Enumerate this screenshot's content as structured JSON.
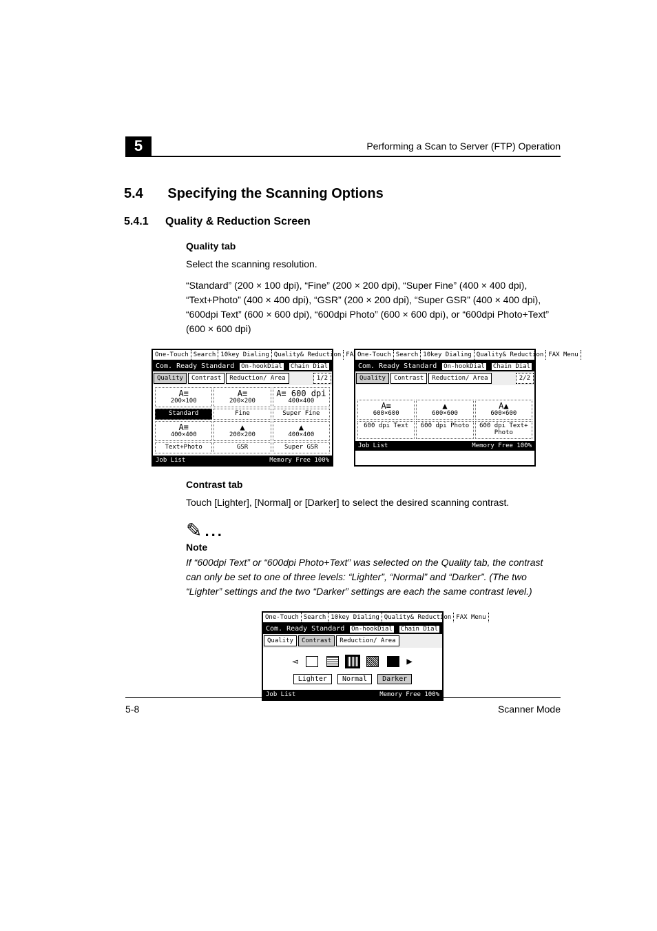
{
  "chapter_number": "5",
  "running_head": "Performing a Scan to Server (FTP) Operation",
  "section": {
    "number": "5.4",
    "title": "Specifying the Scanning Options"
  },
  "subsection": {
    "number": "5.4.1",
    "title": "Quality & Reduction Screen"
  },
  "quality": {
    "heading": "Quality tab",
    "intro": "Select the scanning resolution.",
    "body": "“Standard” (200 × 100 dpi), “Fine” (200 × 200 dpi), “Super Fine” (400 × 400 dpi), “Text+Photo” (400 × 400 dpi), “GSR” (200 × 200 dpi), “Super GSR” (400 × 400 dpi), “600dpi Text” (600 × 600 dpi), “600dpi Photo” (600 × 600 dpi), or “600dpi Photo+Text” (600 × 600 dpi)"
  },
  "contrast": {
    "heading": "Contrast tab",
    "body": "Touch [Lighter], [Normal] or [Darker] to select the desired scanning contrast."
  },
  "note": {
    "label": "Note",
    "body": "If “600dpi Text” or “600dpi Photo+Text” was selected on the Quality tab, the contrast can only be set to one of three levels: “Lighter”, “Normal” and “Darker”. (The two “Lighter” settings and the two “Darker” settings are each the same contrast level.)"
  },
  "screen_common": {
    "top_tabs": [
      "One-Touch",
      "Search",
      "10key Dialing",
      "Quality& Reduction",
      "FAX Menu"
    ],
    "status_left": "Com. Ready",
    "status_mid": "Standard",
    "status_btn1": "On-hookDial",
    "status_btn2": "Chain Dial",
    "sub_tabs": [
      "Quality",
      "Contrast",
      "Reduction/ Area"
    ],
    "job_list": "Job List",
    "memory": "Memory Free 100%"
  },
  "screen1": {
    "page_indicator": "1/2",
    "row1": [
      {
        "label": "200×100",
        "caption": "A≡",
        "selected": false
      },
      {
        "label": "200×200",
        "caption": "A≡",
        "selected": false
      },
      {
        "label": "400×400",
        "caption": "A≡ 600 dpi",
        "selected": false
      }
    ],
    "row2": [
      {
        "label": "Standard",
        "selected": true
      },
      {
        "label": "Fine",
        "selected": false
      },
      {
        "label": "Super Fine",
        "selected": false
      }
    ],
    "row3": [
      {
        "label": "400×400",
        "caption": "A≡",
        "selected": false
      },
      {
        "label": "200×200",
        "caption": "▲",
        "selected": false
      },
      {
        "label": "400×400",
        "caption": "▲",
        "selected": false
      }
    ],
    "row4": [
      {
        "label": "Text+Photo",
        "selected": false
      },
      {
        "label": "GSR",
        "selected": false
      },
      {
        "label": "Super GSR",
        "selected": false
      }
    ]
  },
  "screen2": {
    "page_indicator": "2/2",
    "row1": [
      {
        "label": "600×600",
        "caption": "A≡",
        "selected": false
      },
      {
        "label": "600×600",
        "caption": "▲",
        "selected": false
      },
      {
        "label": "600×600",
        "caption": "A▲",
        "selected": false
      }
    ],
    "row2": [
      {
        "label": "600 dpi Text",
        "selected": false
      },
      {
        "label": "600 dpi Photo",
        "selected": false
      },
      {
        "label": "600 dpi Text+ Photo",
        "selected": false
      }
    ]
  },
  "screen3": {
    "buttons": [
      "Lighter",
      "Normal",
      "Darker"
    ],
    "active_index": 2
  },
  "footer": {
    "left": "5-8",
    "right": "Scanner Mode"
  }
}
